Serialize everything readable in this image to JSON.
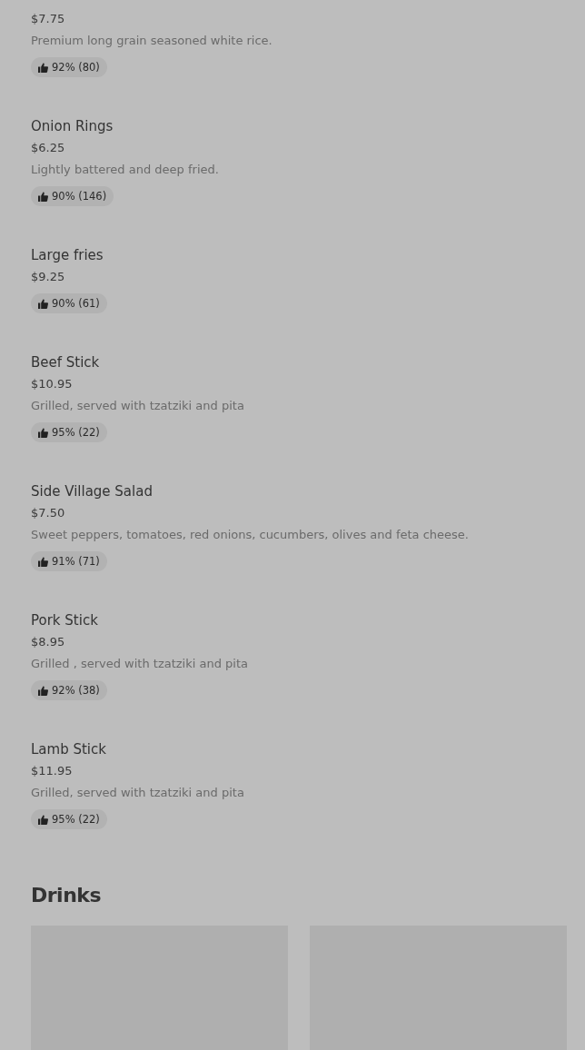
{
  "items": [
    {
      "price": "$7.75",
      "description": "Premium long grain seasoned white rice.",
      "rating": "92% (80)"
    },
    {
      "name": "Onion Rings",
      "price": "$6.25",
      "description": "Lightly battered and deep fried.",
      "rating": "90% (146)"
    },
    {
      "name": "Large fries",
      "price": "$9.25",
      "rating": "90% (61)"
    },
    {
      "name": "Beef Stick",
      "price": "$10.95",
      "description": "Grilled, served with tzatziki and pita",
      "rating": "95% (22)"
    },
    {
      "name": "Side Village Salad",
      "price": "$7.50",
      "description": "Sweet peppers, tomatoes, red onions, cucumbers, olives and feta cheese.",
      "rating": "91% (71)"
    },
    {
      "name": "Pork Stick",
      "price": "$8.95",
      "description": "Grilled , served with tzatziki and pita",
      "rating": "92% (38)"
    },
    {
      "name": "Lamb Stick",
      "price": "$11.95",
      "description": "Grilled, served with tzatziki and pita",
      "rating": "95% (22)"
    }
  ],
  "drinks": {
    "title": "Drinks",
    "cards": [
      {
        "kind": "placeholder"
      },
      {
        "kind": "placeholder"
      }
    ]
  }
}
